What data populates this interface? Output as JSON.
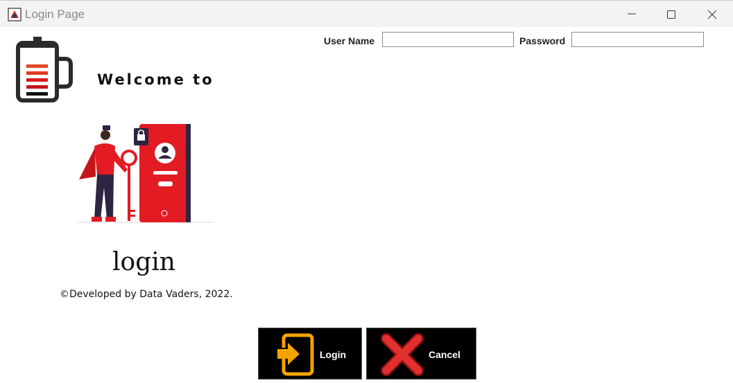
{
  "window": {
    "title": "Login Page",
    "icon": "java-app-icon",
    "controls": [
      "minimize-icon",
      "maximize-icon",
      "close-icon"
    ]
  },
  "form": {
    "username_label": "User Name",
    "username_value": "",
    "password_label": "Password",
    "password_value": ""
  },
  "branding": {
    "welcome_text": "Welcome to",
    "logo_icon": "battery-cup-icon",
    "app_name": "login",
    "credit": "©Developed by Data Vaders, 2022."
  },
  "buttons": {
    "login_label": "Login",
    "login_icon": "login-arrow-icon",
    "cancel_label": "Cancel",
    "cancel_icon": "red-x-icon"
  },
  "colors": {
    "accent_red": "#e31b23",
    "button_bg": "#000000",
    "login_icon_color": "#f5a300",
    "titlebar_bg": "#f3f3f3"
  }
}
